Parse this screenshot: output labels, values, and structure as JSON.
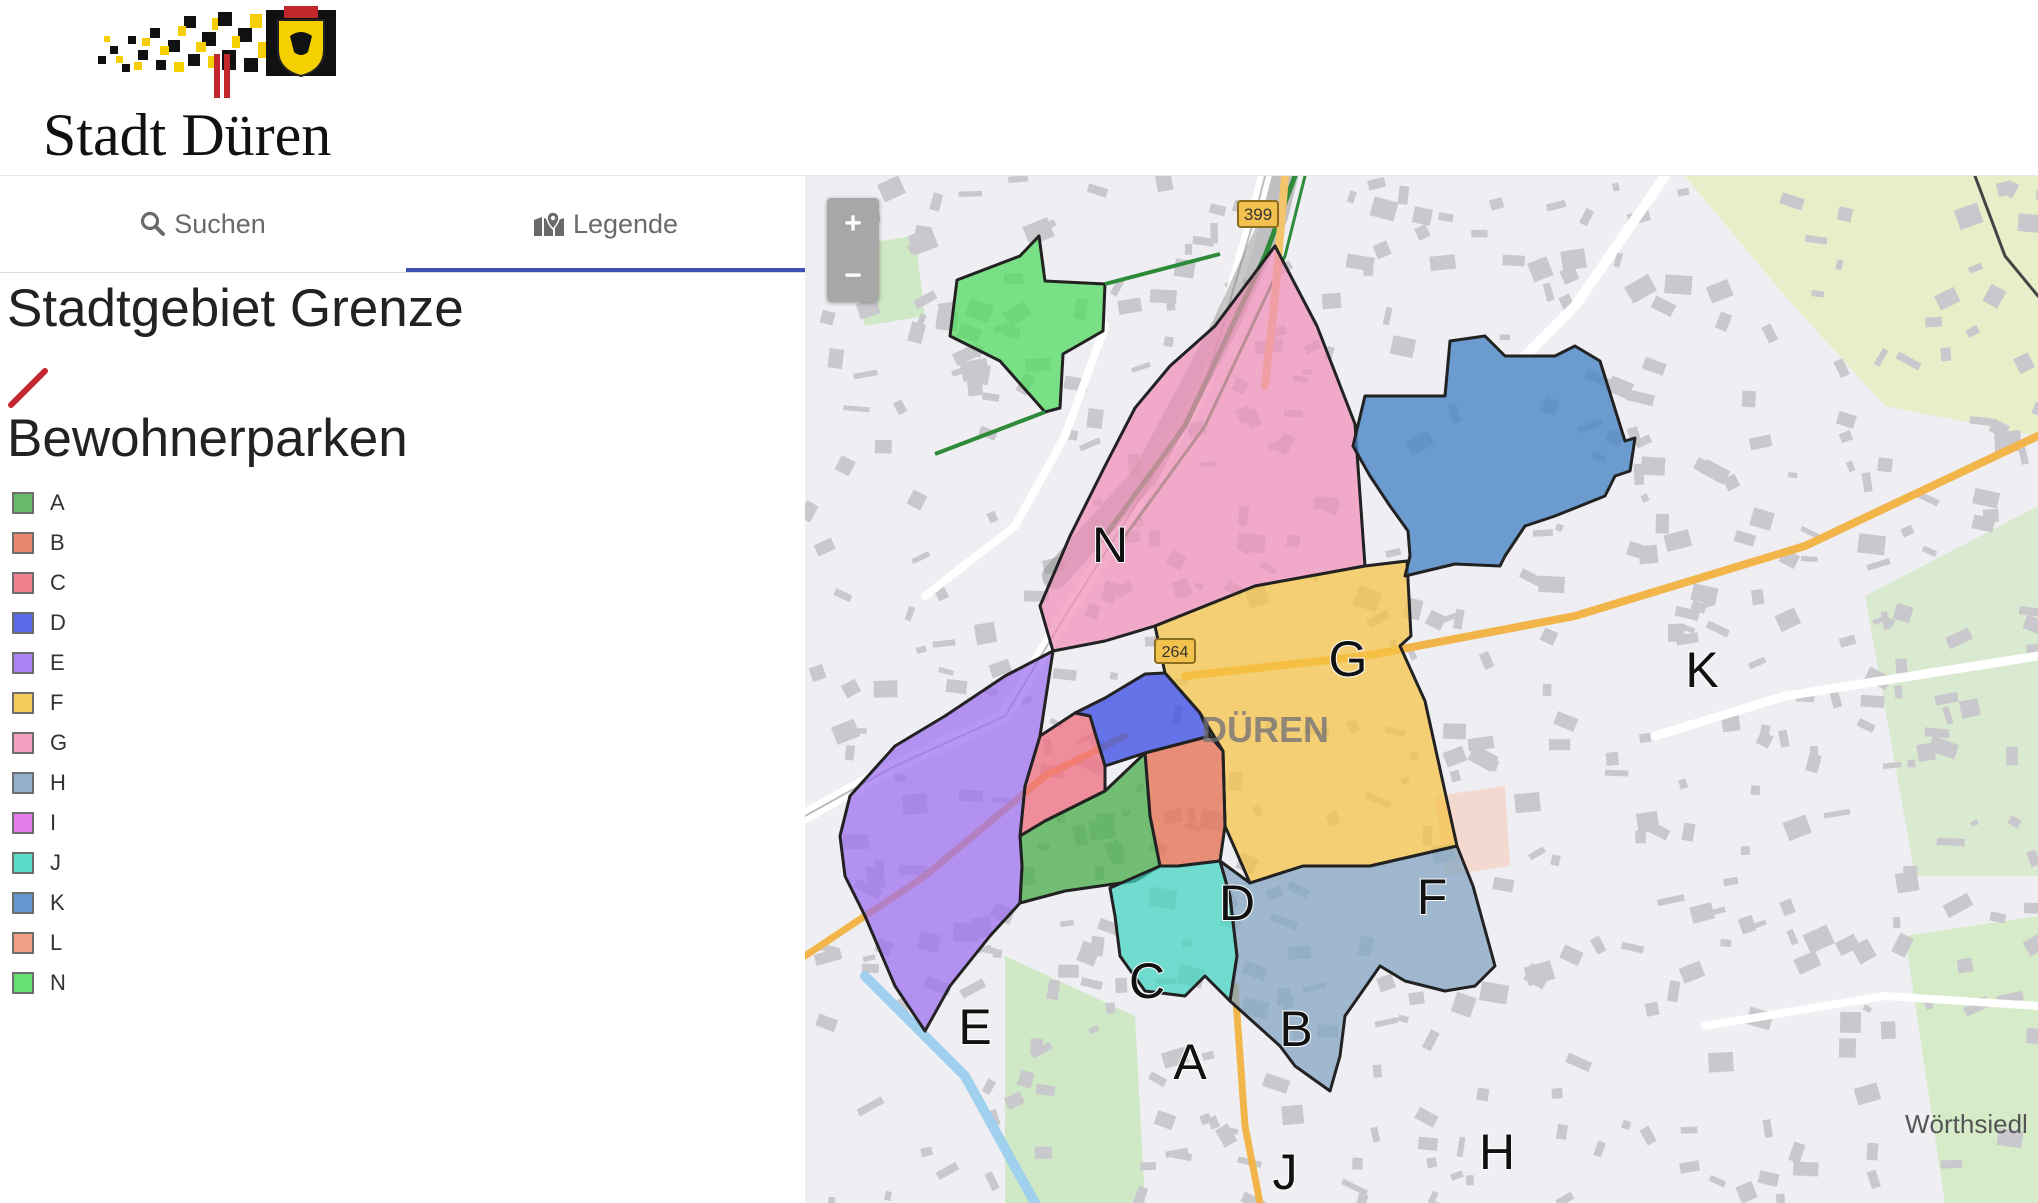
{
  "header": {
    "logo_text": "Stadt Düren"
  },
  "tabs": [
    {
      "label": "Suchen",
      "icon": "search-icon",
      "active": false
    },
    {
      "label": "Legende",
      "icon": "map-marker-icon",
      "active": true
    }
  ],
  "legend": {
    "boundary_title": "Stadtgebiet Grenze",
    "boundary_color": "#c1272d",
    "parking_title": "Bewohnerparken",
    "zones": [
      {
        "label": "A",
        "color": "#4caf50"
      },
      {
        "label": "B",
        "color": "#e57355"
      },
      {
        "label": "C",
        "color": "#f06c7d"
      },
      {
        "label": "D",
        "color": "#3f51e6"
      },
      {
        "label": "E",
        "color": "#9b6ef0"
      },
      {
        "label": "F",
        "color": "#f6c443"
      },
      {
        "label": "G",
        "color": "#f08fb8"
      },
      {
        "label": "H",
        "color": "#7fa3c0"
      },
      {
        "label": "I",
        "color": "#e066e8"
      },
      {
        "label": "J",
        "color": "#3fd6c0"
      },
      {
        "label": "K",
        "color": "#4a86c6"
      },
      {
        "label": "L",
        "color": "#f09070"
      },
      {
        "label": "N",
        "color": "#4cdb5a"
      }
    ]
  },
  "map": {
    "zoom_in_label": "+",
    "zoom_out_label": "−",
    "road_labels": [
      "399",
      "264"
    ],
    "city_label": "DÜREN",
    "district_label": "Wörthsiedl",
    "zone_labels": [
      "N",
      "G",
      "K",
      "D",
      "F",
      "C",
      "E",
      "B",
      "A",
      "J",
      "H"
    ]
  }
}
